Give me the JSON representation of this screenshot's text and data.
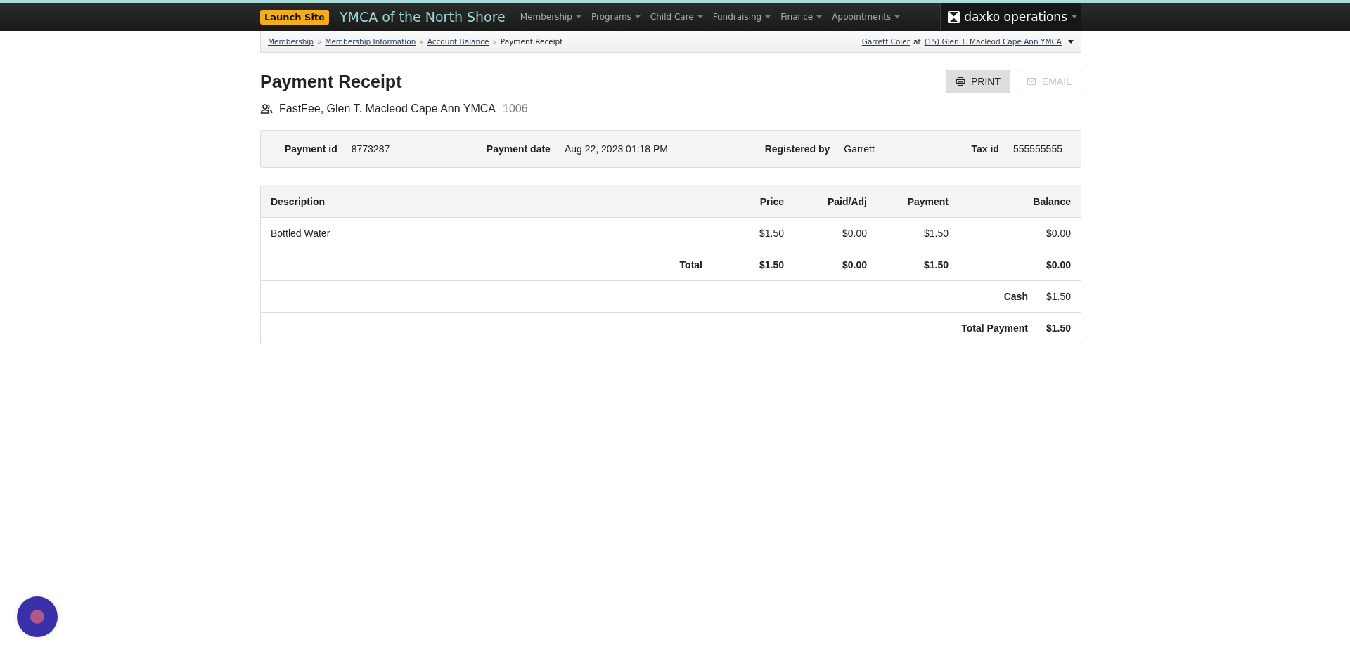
{
  "navbar": {
    "badge": "Launch Site",
    "site_title": "YMCA of the North Shore",
    "menu": [
      {
        "label": "Membership"
      },
      {
        "label": "Programs"
      },
      {
        "label": "Child Care"
      },
      {
        "label": "Fundraising"
      },
      {
        "label": "Finance"
      },
      {
        "label": "Appointments"
      }
    ],
    "brand": "daxko operations"
  },
  "breadcrumb": {
    "links": [
      "Membership",
      "Membership Information",
      "Account Balance"
    ],
    "separator": "»",
    "current": "Payment Receipt",
    "user": "Garrett Coler",
    "at": "at",
    "location": "(15) Glen T. Macleod Cape Ann YMCA"
  },
  "page": {
    "title": "Payment Receipt",
    "buttons": [
      {
        "kind": "print",
        "label": "PRINT",
        "disabled": false
      },
      {
        "kind": "email",
        "label": "EMAIL",
        "disabled": true
      }
    ],
    "account": {
      "name": "FastFee, Glen T. Macleod Cape Ann YMCA",
      "number": "1006"
    }
  },
  "details": [
    {
      "label": "Payment id",
      "value": "8773287"
    },
    {
      "label": "Payment date",
      "value": "Aug 22, 2023 01:18 PM"
    },
    {
      "label": "Registered by",
      "value": "Garrett"
    },
    {
      "label": "Tax id",
      "value": "555555555"
    }
  ],
  "table": {
    "columns": [
      "Description",
      "Price",
      "Paid/Adj",
      "Payment",
      "Balance"
    ],
    "rows": [
      {
        "description": "Bottled Water",
        "price": "$1.50",
        "paid_adj": "$0.00",
        "payment": "$1.50",
        "balance": "$0.00"
      }
    ],
    "total": {
      "label": "Total",
      "price": "$1.50",
      "paid_adj": "$0.00",
      "payment": "$1.50",
      "balance": "$0.00"
    },
    "tenders": [
      {
        "label": "Cash",
        "amount": "$1.50",
        "bold": false
      },
      {
        "label": "Total Payment",
        "amount": "$1.50",
        "bold": true
      }
    ]
  }
}
